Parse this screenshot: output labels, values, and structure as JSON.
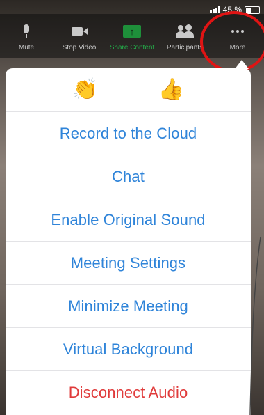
{
  "status": {
    "battery": "45 %"
  },
  "toolbar": {
    "items": [
      {
        "label": "Mute",
        "icon": "microphone-icon"
      },
      {
        "label": "Stop Video",
        "icon": "video-camera-icon"
      },
      {
        "label": "Share Content",
        "icon": "share-screen-icon"
      },
      {
        "label": "Participants",
        "icon": "participants-icon"
      },
      {
        "label": "More",
        "icon": "more-dots-icon"
      }
    ]
  },
  "reactions": [
    {
      "glyph": "👏",
      "icon": "clapping-hands-icon"
    },
    {
      "glyph": "👍",
      "icon": "thumbs-up-icon"
    }
  ],
  "menu": {
    "items": [
      {
        "label": "Record to the Cloud"
      },
      {
        "label": "Chat"
      },
      {
        "label": "Enable Original Sound"
      },
      {
        "label": "Meeting Settings"
      },
      {
        "label": "Minimize Meeting"
      },
      {
        "label": "Virtual Background"
      },
      {
        "label": "Disconnect Audio"
      }
    ]
  },
  "colors": {
    "menu_text": "#2f84d9",
    "danger_text": "#e03b3b",
    "share_green": "#24b04a",
    "highlight_red": "#e01414"
  }
}
